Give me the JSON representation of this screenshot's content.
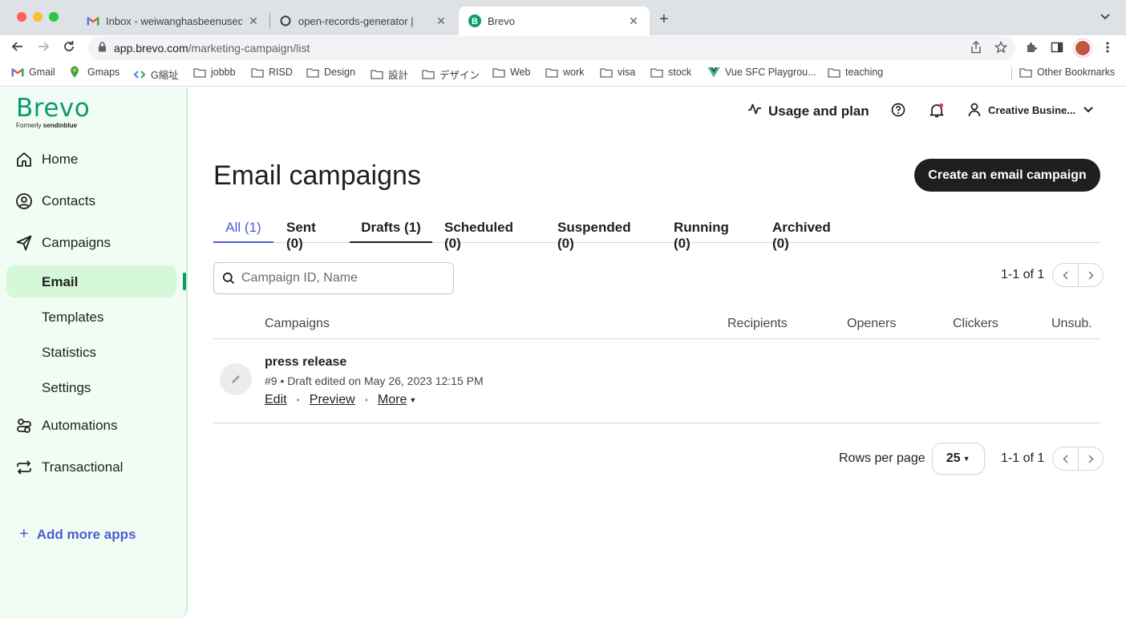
{
  "browser": {
    "tabs": [
      {
        "title": "Inbox - weiwanghasbeenused@",
        "icon": "gmail-icon",
        "active": false
      },
      {
        "title": "open-records-generator |",
        "icon": "circle-icon",
        "active": false
      },
      {
        "title": "Brevo",
        "icon": "brevo-icon",
        "active": true
      }
    ],
    "url_host": "app.brevo.com",
    "url_path": "/marketing-campaign/list",
    "bookmarks": [
      {
        "label": "Gmail",
        "icon": "gmail-icon"
      },
      {
        "label": "Gmaps",
        "icon": "map-pin-icon"
      },
      {
        "label": "G縮址",
        "icon": "code-icon"
      },
      {
        "label": "jobbb",
        "icon": "folder-icon"
      },
      {
        "label": "RISD",
        "icon": "folder-icon"
      },
      {
        "label": "Design",
        "icon": "folder-icon"
      },
      {
        "label": "設計",
        "icon": "folder-icon"
      },
      {
        "label": "デザイン",
        "icon": "folder-icon"
      },
      {
        "label": "Web",
        "icon": "folder-icon"
      },
      {
        "label": "work",
        "icon": "folder-icon"
      },
      {
        "label": "visa",
        "icon": "folder-icon"
      },
      {
        "label": "stock",
        "icon": "folder-icon"
      },
      {
        "label": "Vue SFC Playgrou...",
        "icon": "vue-icon"
      },
      {
        "label": "teaching",
        "icon": "folder-icon"
      }
    ],
    "other_bookmarks": "Other Bookmarks"
  },
  "sidebar": {
    "logo": "Brevo",
    "logo_sub_prefix": "Formerly",
    "logo_sub_brand": "sendinblue",
    "nav": {
      "home": "Home",
      "contacts": "Contacts",
      "campaigns": "Campaigns",
      "automations": "Automations",
      "transactional": "Transactional"
    },
    "sub": {
      "email": "Email",
      "templates": "Templates",
      "statistics": "Statistics",
      "settings": "Settings"
    },
    "add_apps": "Add more apps"
  },
  "topbar": {
    "usage": "Usage and plan",
    "account": "Creative Busine..."
  },
  "main": {
    "title": "Email campaigns",
    "create_button": "Create an email campaign",
    "tabs": [
      "All (1)",
      "Sent (0)",
      "Drafts (1)",
      "Scheduled (0)",
      "Suspended (0)",
      "Running (0)",
      "Archived (0)"
    ],
    "search_placeholder": "Campaign ID, Name",
    "pager_text": "1-1 of 1",
    "columns": [
      "Campaigns",
      "Recipients",
      "Openers",
      "Clickers",
      "Unsub."
    ],
    "rows": [
      {
        "name": "press release",
        "meta": "#9 • Draft edited on May 26, 2023 12:15 PM",
        "actions": [
          "Edit",
          "Preview",
          "More"
        ]
      }
    ],
    "rows_per_page_label": "Rows per page",
    "rows_per_page_value": "25"
  },
  "colors": {
    "brand_green": "#0b996e",
    "sidebar_bg": "#f1fdf4",
    "active_item_bg": "#d5f8d9",
    "accent_blue": "#4d5bd1",
    "button_dark": "#1f1f1f"
  }
}
